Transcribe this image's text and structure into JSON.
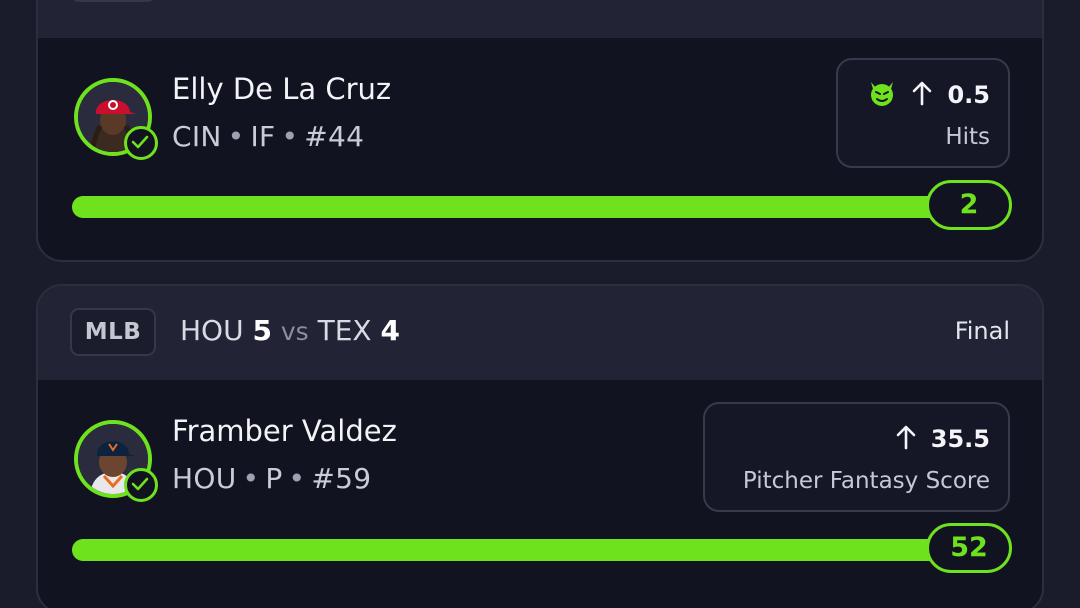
{
  "cards": [
    {
      "player": {
        "name": "Elly De La Cruz",
        "team": "CIN",
        "position": "IF",
        "number": "#44",
        "avatar": "player-headshot-reds-cap"
      },
      "pick": {
        "icon": "demon-face-icon",
        "direction": "up-arrow-icon",
        "line": "0.5",
        "stat": "Hits"
      },
      "result": {
        "value": "2",
        "progress_percent": 100
      }
    },
    {
      "league": "MLB",
      "game": {
        "home_team": "HOU",
        "home_score": "5",
        "vs": "vs",
        "away_team": "TEX",
        "away_score": "4",
        "status": "Final"
      },
      "player": {
        "name": "Framber Valdez",
        "team": "HOU",
        "position": "P",
        "number": "#59",
        "avatar": "player-headshot-astros-cap"
      },
      "pick": {
        "direction": "up-arrow-icon",
        "line": "35.5",
        "stat": "Pitcher Fantasy Score"
      },
      "result": {
        "value": "52",
        "progress_percent": 100
      }
    }
  ],
  "colors": {
    "accent": "#6ee21d",
    "background": "#1b1c2b",
    "card": "#121321",
    "card_header": "#222436"
  },
  "separator": "•"
}
